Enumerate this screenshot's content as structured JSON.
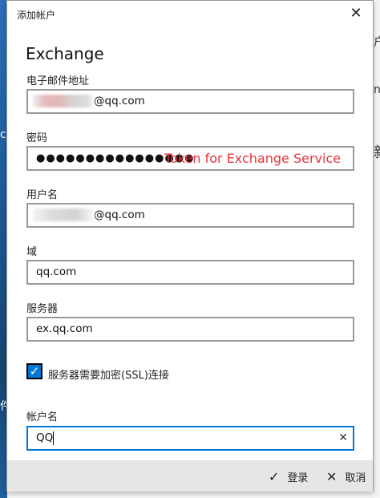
{
  "background": {
    "left_fragments": [
      "c.",
      "件"
    ],
    "right_fragments": [
      "户",
      "n",
      "新"
    ]
  },
  "dialog": {
    "title": "添加帐户",
    "heading": "Exchange",
    "fields": {
      "email": {
        "label": "电子邮件地址",
        "value_visible": "@qq.com"
      },
      "password": {
        "label": "密码",
        "masked": "●●●●●●●●●●●●●●●●",
        "annotation": "Token for Exchange Service"
      },
      "username": {
        "label": "用户名",
        "value_visible": "@qq.com"
      },
      "domain": {
        "label": "域",
        "value": "qq.com"
      },
      "server": {
        "label": "服务器",
        "value": "ex.qq.com"
      },
      "ssl": {
        "label": "服务器需要加密(SSL)连接",
        "checked": true
      },
      "account_name": {
        "label": "帐户名",
        "value": "QQ"
      }
    },
    "footer": {
      "login": "登录",
      "cancel": "取消"
    },
    "accent": "#0078d7"
  }
}
